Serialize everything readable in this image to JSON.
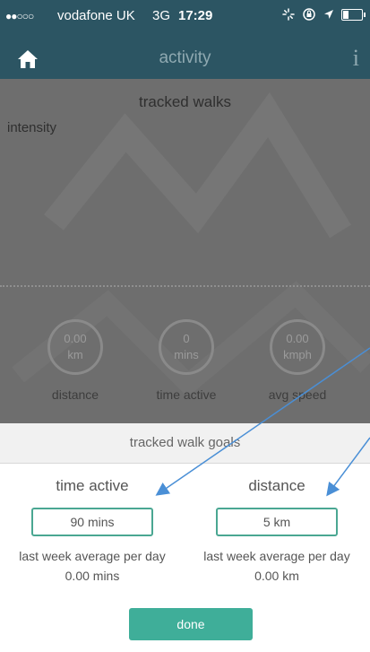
{
  "status_bar": {
    "signal": "●●○○○",
    "carrier": "vodafone UK",
    "network": "3G",
    "time": "17:29"
  },
  "nav": {
    "title": "activity",
    "info": "i"
  },
  "chart": {
    "title": "tracked walks",
    "ylabel": "intensity"
  },
  "stats": [
    {
      "value": "0.00",
      "unit": "km",
      "label": "distance"
    },
    {
      "value": "0",
      "unit": "mins",
      "label": "time active"
    },
    {
      "value": "0.00",
      "unit": "kmph",
      "label": "avg speed"
    }
  ],
  "goals": {
    "header": "tracked walk goals",
    "time_active": {
      "title": "time active",
      "value": "90 mins",
      "avg_label": "last week average per day",
      "avg_value": "0.00 mins"
    },
    "distance": {
      "title": "distance",
      "value": "5 km",
      "avg_label": "last week average per day",
      "avg_value": "0.00 km"
    },
    "done_label": "done"
  },
  "colors": {
    "header_bg": "#2c5563",
    "accent": "#3fae99",
    "overlay": "#6e6e6e",
    "annotation_arrow": "#4a8fd6"
  }
}
